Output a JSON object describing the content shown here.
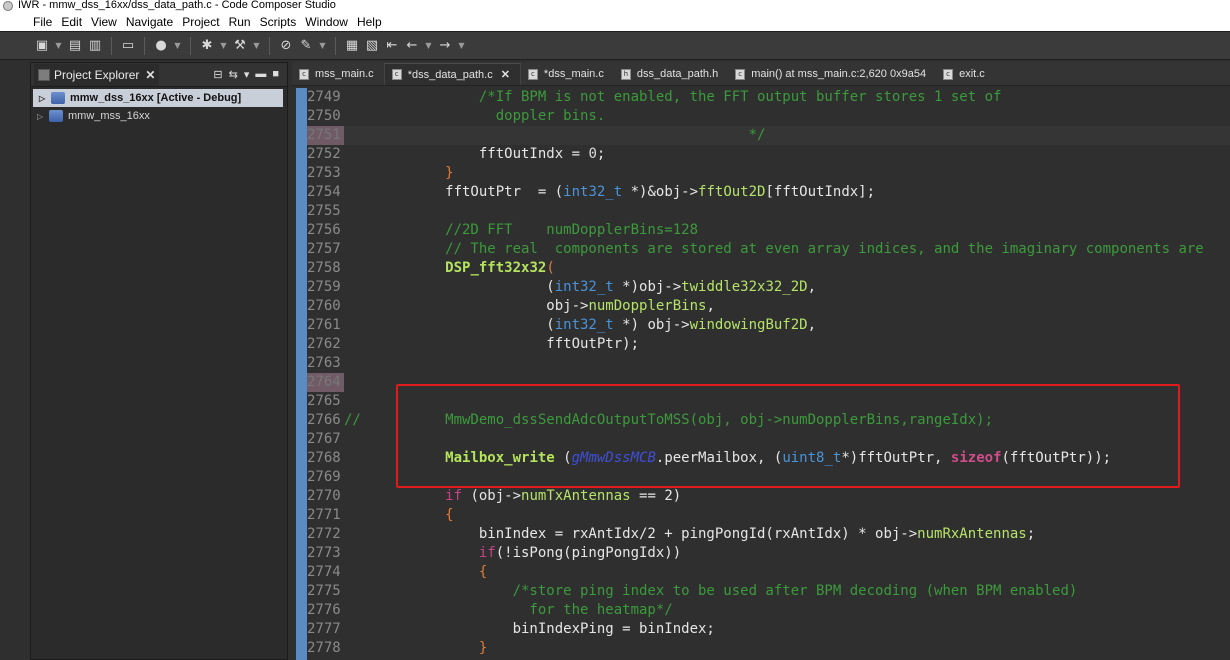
{
  "window": {
    "title": "IWR - mmw_dss_16xx/dss_data_path.c - Code Composer Studio"
  },
  "menu": [
    "File",
    "Edit",
    "View",
    "Navigate",
    "Project",
    "Run",
    "Scripts",
    "Window",
    "Help"
  ],
  "explorer": {
    "tab_label": "Project Explorer",
    "projects": [
      {
        "name": "mmw_dss_16xx  [Active - Debug]",
        "selected": true
      },
      {
        "name": "mmw_mss_16xx",
        "selected": false
      }
    ]
  },
  "editor": {
    "tabs": [
      {
        "label": "mss_main.c",
        "active": false,
        "icon": "c-file-icon"
      },
      {
        "label": "*dss_data_path.c",
        "active": true,
        "icon": "c-file-icon"
      },
      {
        "label": "*dss_main.c",
        "active": false,
        "icon": "c-file-icon"
      },
      {
        "label": "dss_data_path.h",
        "active": false,
        "icon": "h-file-icon"
      },
      {
        "label": "main() at mss_main.c:2,620 0x9a54",
        "active": false,
        "icon": "debug-icon"
      },
      {
        "label": "exit.c",
        "active": false,
        "icon": "c-file-icon"
      }
    ],
    "lines": [
      {
        "n": "2749",
        "tokens": [
          [
            "                /*If BPM is not enabled, the FFT output buffer stores 1 set of",
            "c-cm"
          ]
        ]
      },
      {
        "n": "2750",
        "tokens": [
          [
            "                  doppler bins.",
            "c-cm"
          ]
        ]
      },
      {
        "n": "2751",
        "tokens": [
          [
            "                                                */",
            "c-cm"
          ]
        ],
        "marked": true,
        "current": true
      },
      {
        "n": "2752",
        "tokens": [
          [
            "                fftOutIndx = ",
            "c-plain"
          ],
          [
            "0",
            "c-num"
          ],
          [
            ";",
            "c-plain"
          ]
        ]
      },
      {
        "n": "2753",
        "tokens": [
          [
            "            }",
            "c-orange"
          ]
        ]
      },
      {
        "n": "2754",
        "tokens": [
          [
            "            fftOutPtr  = (",
            "c-plain"
          ],
          [
            "int32_t",
            "c-ty"
          ],
          [
            " *)&obj->",
            "c-plain"
          ],
          [
            "fftOut2D",
            "c-field"
          ],
          [
            "[fftOutIndx];",
            "c-plain"
          ]
        ]
      },
      {
        "n": "2755",
        "tokens": [
          [
            "",
            "c-plain"
          ]
        ]
      },
      {
        "n": "2756",
        "tokens": [
          [
            "            //2D FFT    numDopplerBins=128",
            "c-cm"
          ]
        ]
      },
      {
        "n": "2757",
        "tokens": [
          [
            "            // The real  components are stored at even array indices, and the imaginary components are",
            "c-cm"
          ]
        ]
      },
      {
        "n": "2758",
        "tokens": [
          [
            "            ",
            "c-plain"
          ],
          [
            "DSP_fft32x32",
            "c-fnb"
          ],
          [
            "(",
            "c-orange"
          ]
        ]
      },
      {
        "n": "2759",
        "tokens": [
          [
            "                        (",
            "c-plain"
          ],
          [
            "int32_t",
            "c-ty"
          ],
          [
            " *)obj->",
            "c-plain"
          ],
          [
            "twiddle32x32_2D",
            "c-field"
          ],
          [
            ",",
            "c-plain"
          ]
        ]
      },
      {
        "n": "2760",
        "tokens": [
          [
            "                        obj->",
            "c-plain"
          ],
          [
            "numDopplerBins",
            "c-field"
          ],
          [
            ",",
            "c-plain"
          ]
        ]
      },
      {
        "n": "2761",
        "tokens": [
          [
            "                        (",
            "c-plain"
          ],
          [
            "int32_t",
            "c-ty"
          ],
          [
            " *) obj->",
            "c-plain"
          ],
          [
            "windowingBuf2D",
            "c-field"
          ],
          [
            ",",
            "c-plain"
          ]
        ]
      },
      {
        "n": "2762",
        "tokens": [
          [
            "                        fftOutPtr);",
            "c-plain"
          ]
        ]
      },
      {
        "n": "2763",
        "tokens": [
          [
            "",
            "c-plain"
          ]
        ]
      },
      {
        "n": "2764",
        "tokens": [
          [
            "",
            "c-plain"
          ]
        ],
        "marked": true
      },
      {
        "n": "2765",
        "tokens": [
          [
            "",
            "c-plain"
          ]
        ]
      },
      {
        "n": "2766",
        "tokens": [
          [
            "//          MmwDemo_dssSendAdcOutputToMSS(obj, obj->numDopplerBins,rangeIdx);",
            "c-cm"
          ]
        ]
      },
      {
        "n": "2767",
        "tokens": [
          [
            "",
            "c-plain"
          ]
        ]
      },
      {
        "n": "2768",
        "tokens": [
          [
            "            ",
            "c-plain"
          ],
          [
            "Mailbox_write",
            "c-fnb"
          ],
          [
            " (",
            "c-plain"
          ],
          [
            "gMmwDssMCB",
            "c-ital"
          ],
          [
            ".peerMailbox, (",
            "c-plain"
          ],
          [
            "uint8_t",
            "c-ty"
          ],
          [
            "*)fftOutPtr, ",
            "c-plain"
          ],
          [
            "sizeof",
            "c-kw"
          ],
          [
            "(fftOutPtr));",
            "c-plain"
          ]
        ]
      },
      {
        "n": "2769",
        "tokens": [
          [
            "",
            "c-plain"
          ]
        ]
      },
      {
        "n": "2770",
        "tokens": [
          [
            "            ",
            "c-plain"
          ],
          [
            "if",
            "c-kw2"
          ],
          [
            " (obj->",
            "c-plain"
          ],
          [
            "numTxAntennas",
            "c-field"
          ],
          [
            " == 2)",
            "c-plain"
          ]
        ]
      },
      {
        "n": "2771",
        "tokens": [
          [
            "            {",
            "c-orange"
          ]
        ]
      },
      {
        "n": "2772",
        "tokens": [
          [
            "                binIndex = rxAntIdx/2 + pingPongId(rxAntIdx) * obj->",
            "c-plain"
          ],
          [
            "numRxAntennas",
            "c-field"
          ],
          [
            ";",
            "c-plain"
          ]
        ]
      },
      {
        "n": "2773",
        "tokens": [
          [
            "                ",
            "c-plain"
          ],
          [
            "if",
            "c-kw2"
          ],
          [
            "(!isPong(pingPongIdx))",
            "c-plain"
          ]
        ]
      },
      {
        "n": "2774",
        "tokens": [
          [
            "                {",
            "c-orange"
          ]
        ]
      },
      {
        "n": "2775",
        "tokens": [
          [
            "                    /*store ping index to be used after BPM decoding (when BPM enabled)",
            "c-cm"
          ]
        ]
      },
      {
        "n": "2776",
        "tokens": [
          [
            "                      for the heatmap*/",
            "c-cm"
          ]
        ]
      },
      {
        "n": "2777",
        "tokens": [
          [
            "                    binIndexPing = binIndex;",
            "c-plain"
          ]
        ]
      },
      {
        "n": "2778",
        "tokens": [
          [
            "                }",
            "c-orange"
          ]
        ]
      }
    ]
  }
}
